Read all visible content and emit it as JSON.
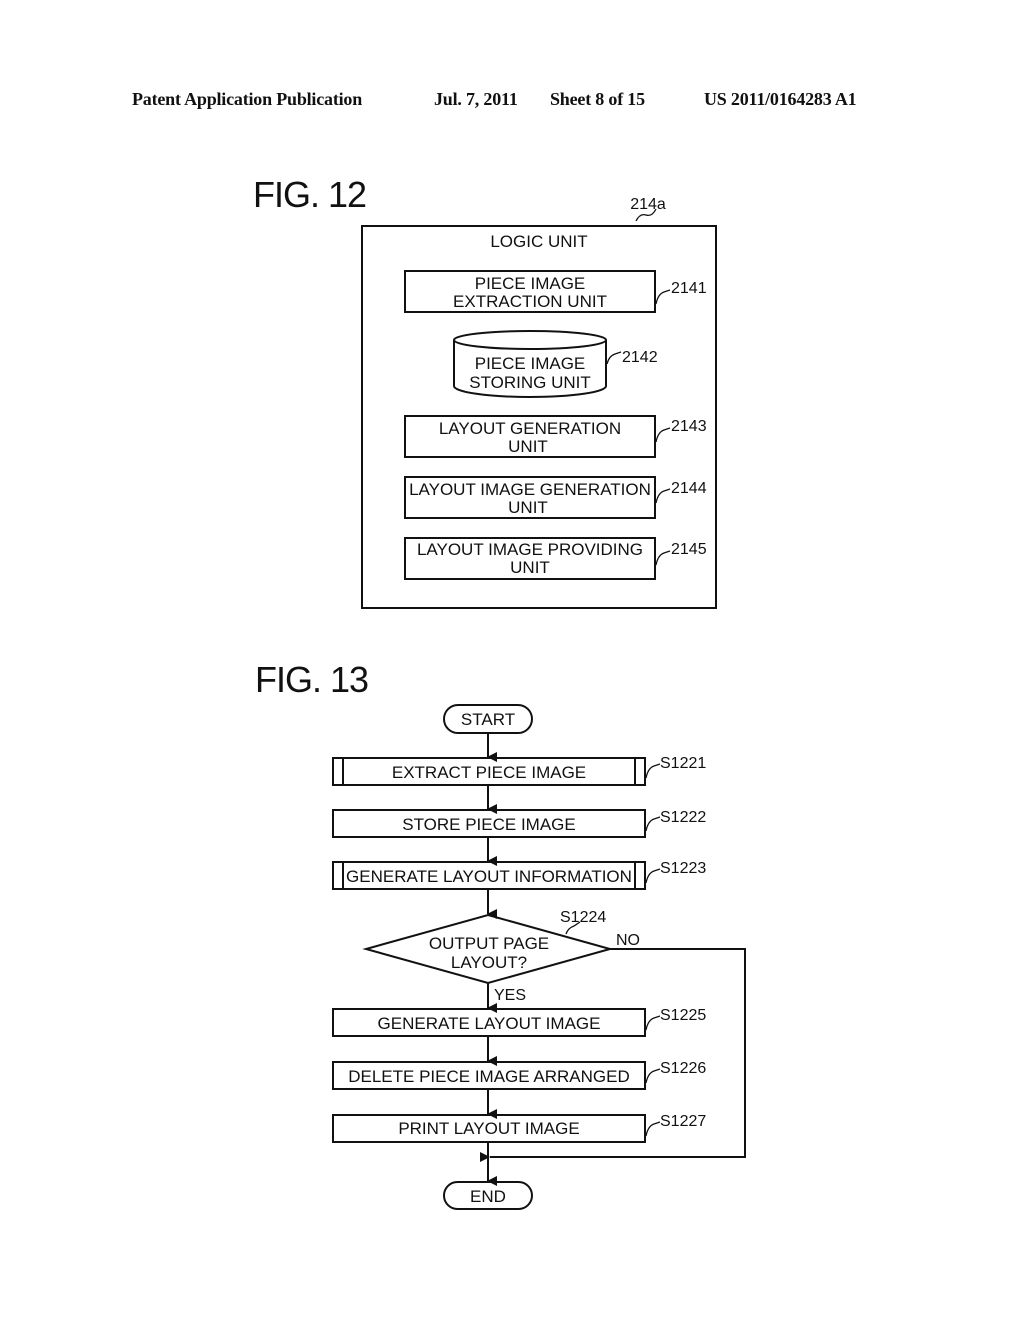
{
  "header": {
    "publication": "Patent Application Publication",
    "date": "Jul. 7, 2011",
    "sheet": "Sheet 8 of 15",
    "number": "US 2011/0164283 A1"
  },
  "fig12": {
    "label": "FIG. 12",
    "container_ref": "214a",
    "container_title": "LOGIC UNIT",
    "units": [
      {
        "line1": "PIECE IMAGE",
        "line2": "EXTRACTION UNIT",
        "ref": "2141"
      },
      {
        "line1": "PIECE IMAGE",
        "line2": "STORING UNIT",
        "ref": "2142"
      },
      {
        "line1": "LAYOUT GENERATION",
        "line2": "UNIT",
        "ref": "2143"
      },
      {
        "line1": "LAYOUT IMAGE GENERATION",
        "line2": "UNIT",
        "ref": "2144"
      },
      {
        "line1": "LAYOUT IMAGE PROVIDING",
        "line2": "UNIT",
        "ref": "2145"
      }
    ]
  },
  "fig13": {
    "label": "FIG. 13",
    "start": "START",
    "end": "END",
    "steps": [
      {
        "text": "EXTRACT PIECE IMAGE",
        "ref": "S1221"
      },
      {
        "text": "STORE PIECE IMAGE",
        "ref": "S1222"
      },
      {
        "text": "GENERATE LAYOUT INFORMATION",
        "ref": "S1223"
      },
      {
        "text": "GENERATE LAYOUT IMAGE",
        "ref": "S1225"
      },
      {
        "text": "DELETE PIECE IMAGE ARRANGED",
        "ref": "S1226"
      },
      {
        "text": "PRINT LAYOUT IMAGE",
        "ref": "S1227"
      }
    ],
    "decision": {
      "line1": "OUTPUT PAGE",
      "line2": "LAYOUT?",
      "ref": "S1224",
      "yes": "YES",
      "no": "NO"
    }
  }
}
